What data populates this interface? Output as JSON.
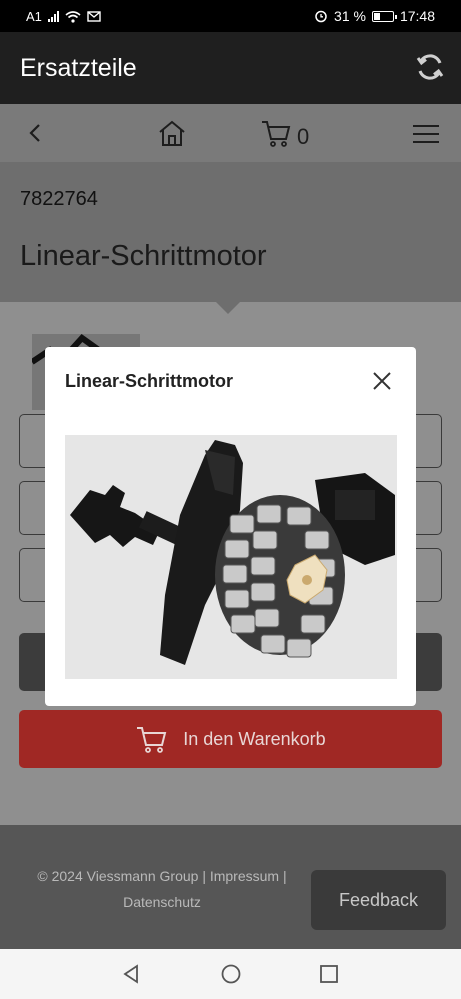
{
  "status_bar": {
    "carrier": "A1",
    "battery": "31 %",
    "battery_level": 0.31,
    "time": "17:48",
    "icons": [
      "signal-icon",
      "wifi-icon",
      "mail-icon",
      "alarm-icon",
      "battery-icon"
    ]
  },
  "app_bar": {
    "title": "Ersatzteile",
    "refresh_icon": "refresh-icon"
  },
  "nav": {
    "back_icon": "back-icon",
    "home_icon": "home-icon",
    "cart_icon": "cart-icon",
    "cart_count": "0",
    "menu_icon": "hamburger-menu-icon"
  },
  "product": {
    "number": "7822764",
    "name": "Linear-Schrittmotor"
  },
  "actions": {
    "add_to_cart_label": "In den Warenkorb"
  },
  "footer": {
    "line1": "© 2024 Viessmann Group | Impressum |",
    "line2": "Datenschutz",
    "feedback_label": "Feedback"
  },
  "modal": {
    "title": "Linear-Schrittmotor",
    "close_icon": "close-icon"
  },
  "colors": {
    "accent": "#a02824",
    "header": "#1f1f1f"
  }
}
